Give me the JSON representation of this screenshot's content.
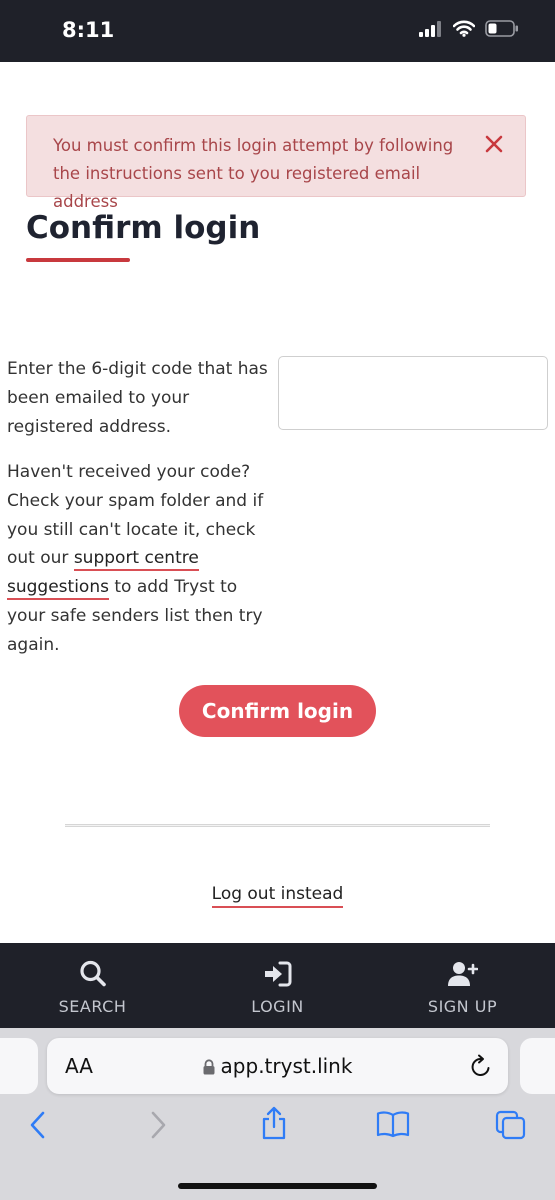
{
  "status_bar": {
    "time": "8:11"
  },
  "alert": {
    "message": "You must confirm this login attempt by following the instructions sent to you registered email address"
  },
  "page": {
    "title": "Confirm login",
    "instructions": "Enter the 6-digit code that has been emailed to your registered address.",
    "help_before": "Haven't received your code? Check your spam folder and if you still can't locate it, check out our ",
    "help_link": "support centre suggestions",
    "help_after": " to add Tryst to your safe senders list then try again.",
    "code_value": "",
    "confirm_button": "Confirm login",
    "logout_link": "Log out instead"
  },
  "bottom_nav": {
    "items": [
      {
        "label": "SEARCH",
        "icon": "search-icon"
      },
      {
        "label": "LOGIN",
        "icon": "login-icon"
      },
      {
        "label": "SIGN UP",
        "icon": "add-user-icon"
      }
    ]
  },
  "browser": {
    "text_size_label": "AA",
    "url": "app.tryst.link"
  },
  "colors": {
    "dark_bar": "#1f2129",
    "accent": "#e2525b",
    "alert_bg": "#f4dfe0",
    "alert_text": "#a8464a"
  }
}
